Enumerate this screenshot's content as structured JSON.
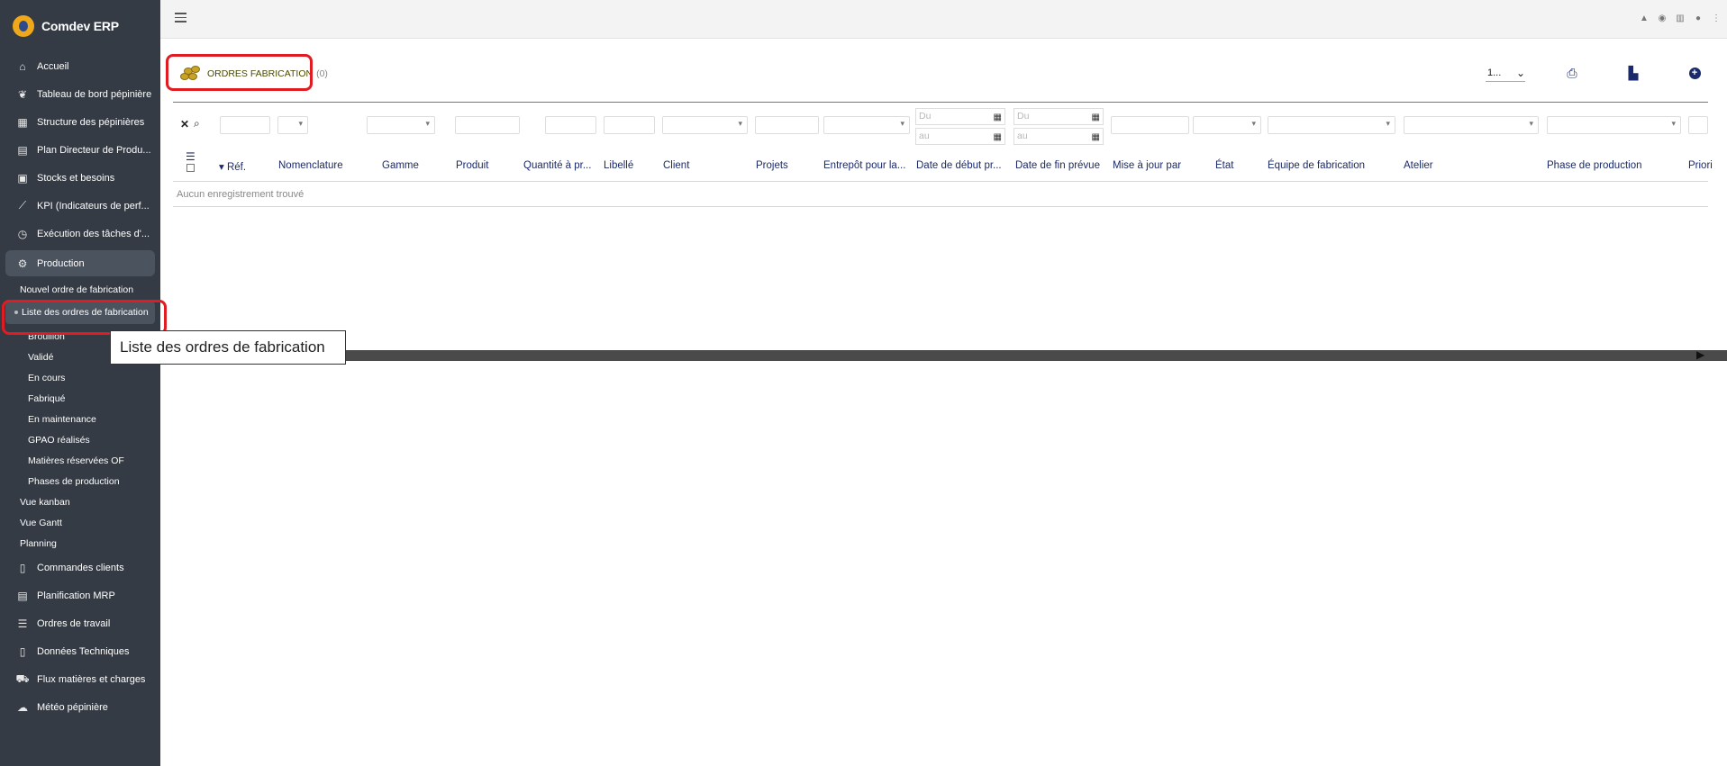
{
  "app": {
    "name": "Comdev ERP"
  },
  "sidebar": {
    "items": [
      {
        "label": "Accueil",
        "icon": "home-icon",
        "glyph": "⌂"
      },
      {
        "label": "Tableau de bord pépinière",
        "icon": "leaf-icon",
        "glyph": "❦"
      },
      {
        "label": "Structure des pépinières",
        "icon": "building-icon",
        "glyph": "▦"
      },
      {
        "label": "Plan Directeur de Produ...",
        "icon": "calendar-icon",
        "glyph": "▤"
      },
      {
        "label": "Stocks et besoins",
        "icon": "boxes-icon",
        "glyph": "▣"
      },
      {
        "label": "KPI (Indicateurs de perf...",
        "icon": "chart-line-icon",
        "glyph": "⟋"
      },
      {
        "label": "Exécution des tâches d'...",
        "icon": "clock-icon",
        "glyph": "◷"
      }
    ],
    "active": {
      "label": "Production",
      "icon": "gears-icon",
      "glyph": "⚙"
    },
    "production_sub": {
      "new_order": "Nouvel ordre de fabrication",
      "order_list": "Liste des ordres de fabrication",
      "statuses": [
        "Brouillon",
        "Validé",
        "En cours",
        "Fabriqué",
        "En maintenance",
        "GPAO réalisés",
        "Matières réservées OF",
        "Phases de production"
      ],
      "views": [
        "Vue kanban",
        "Vue Gantt",
        "Planning"
      ]
    },
    "items_after": [
      {
        "label": "Commandes clients",
        "icon": "document-icon",
        "glyph": "▯"
      },
      {
        "label": "Planification MRP",
        "icon": "calendar-icon",
        "glyph": "▤"
      },
      {
        "label": "Ordres de travail",
        "icon": "task-list-icon",
        "glyph": "☰"
      },
      {
        "label": "Données Techniques",
        "icon": "file-icon",
        "glyph": "▯"
      },
      {
        "label": "Flux matières et charges",
        "icon": "truck-icon",
        "glyph": "⛟"
      },
      {
        "label": "Météo pépinière",
        "icon": "cloud-sun-icon",
        "glyph": "☁"
      }
    ]
  },
  "page": {
    "title": "ORDRES FABRICATION",
    "count": "(0)",
    "pager_value": "1..."
  },
  "filters": {
    "date_from": "Du",
    "date_to": "au"
  },
  "table": {
    "columns": [
      "Réf.",
      "Nomenclature",
      "Gamme",
      "Produit",
      "Quantité à pr...",
      "Libellé",
      "Client",
      "Projets",
      "Entrepôt pour la...",
      "Date de début pr...",
      "Date de fin prévue",
      "Mise à jour par",
      "État",
      "Équipe de fabrication",
      "Atelier",
      "Phase de production",
      "Priori"
    ],
    "empty_message": "Aucun enregistrement trouvé"
  },
  "tooltip": {
    "text": "Liste des ordres de fabrication"
  }
}
